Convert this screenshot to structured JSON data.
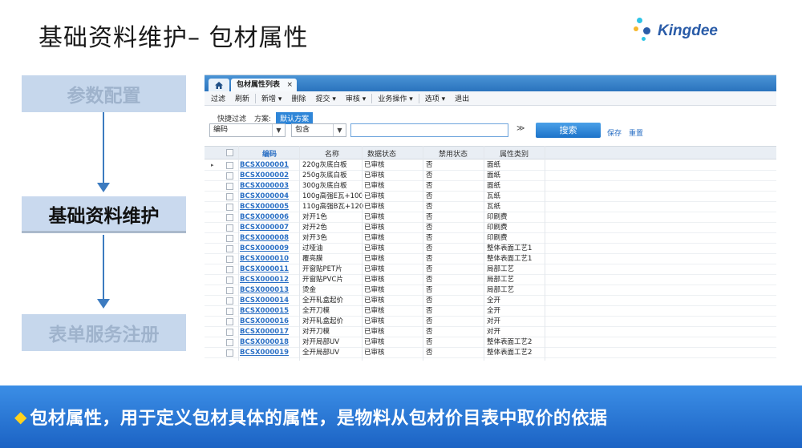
{
  "slide": {
    "title": "基础资料维护– 包材属性",
    "logo_text": "Kingdee",
    "flow_steps": [
      "参数配置",
      "基础资料维护",
      "表单服务注册"
    ],
    "banner_text": "包材属性，用于定义包材具体的属性，是物料从包材价目表中取价的依据"
  },
  "colors": {
    "banner": "#2a78d6",
    "accent": "#2f86d8",
    "flow_active": "#c9d9ee",
    "logo_dots": [
      "#2ec4e6",
      "#f5b82e",
      "#2a5ca8"
    ]
  },
  "app": {
    "home_tab_icon": "home-icon",
    "tab_title": "包材属性列表",
    "tab_close": "×",
    "toolbar": [
      {
        "label": "过滤",
        "dropdown": false
      },
      {
        "label": "刷新",
        "dropdown": false
      },
      {
        "label": "新增",
        "dropdown": true
      },
      {
        "label": "删除",
        "dropdown": false
      },
      {
        "label": "提交",
        "dropdown": true
      },
      {
        "label": "审核",
        "dropdown": true
      },
      {
        "label": "业务操作",
        "dropdown": true
      },
      {
        "label": "选项",
        "dropdown": true
      },
      {
        "label": "退出",
        "dropdown": false
      }
    ],
    "filter": {
      "quick_filter_label": "快捷过滤",
      "scheme_label": "方案:",
      "scheme_value": "默认方案",
      "field_value": "编码",
      "operator_value": "包含",
      "search_value": "",
      "expand_icon": "≫",
      "search_button": "搜索",
      "save_link": "保存",
      "reset_link": "重置"
    },
    "columns": [
      "编码",
      "名称",
      "数据状态",
      "禁用状态",
      "属性类别"
    ],
    "rows": [
      [
        "BCSX000001",
        "220g灰底白板",
        "已审核",
        "否",
        "面纸"
      ],
      [
        "BCSX000002",
        "250g灰底白板",
        "已审核",
        "否",
        "面纸"
      ],
      [
        "BCSX000003",
        "300g灰底白板",
        "已审核",
        "否",
        "面纸"
      ],
      [
        "BCSX000004",
        "100g高强E瓦+100",
        "已审核",
        "否",
        "瓦纸"
      ],
      [
        "BCSX000005",
        "110g高强B瓦+120",
        "已审核",
        "否",
        "瓦纸"
      ],
      [
        "BCSX000006",
        "对开1色",
        "已审核",
        "否",
        "印刷费"
      ],
      [
        "BCSX000007",
        "对开2色",
        "已审核",
        "否",
        "印刷费"
      ],
      [
        "BCSX000008",
        "对开3色",
        "已审核",
        "否",
        "印刷费"
      ],
      [
        "BCSX000009",
        "过哑油",
        "已审核",
        "否",
        "整体表面工艺1"
      ],
      [
        "BCSX000010",
        "覆亮膜",
        "已审核",
        "否",
        "整体表面工艺1"
      ],
      [
        "BCSX000011",
        "开窗贴PET片",
        "已审核",
        "否",
        "局部工艺"
      ],
      [
        "BCSX000012",
        "开窗贴PVC片",
        "已审核",
        "否",
        "局部工艺"
      ],
      [
        "BCSX000013",
        "烫金",
        "已审核",
        "否",
        "局部工艺"
      ],
      [
        "BCSX000014",
        "全开轧盒起价",
        "已审核",
        "否",
        "全开"
      ],
      [
        "BCSX000015",
        "全开刀模",
        "已审核",
        "否",
        "全开"
      ],
      [
        "BCSX000016",
        "对开轧盒起价",
        "已审核",
        "否",
        "对开"
      ],
      [
        "BCSX000017",
        "对开刀模",
        "已审核",
        "否",
        "对开"
      ],
      [
        "BCSX000018",
        "对开局部UV",
        "已审核",
        "否",
        "整体表面工艺2"
      ],
      [
        "BCSX000019",
        "全开局部UV",
        "已审核",
        "否",
        "整体表面工艺2"
      ]
    ]
  }
}
